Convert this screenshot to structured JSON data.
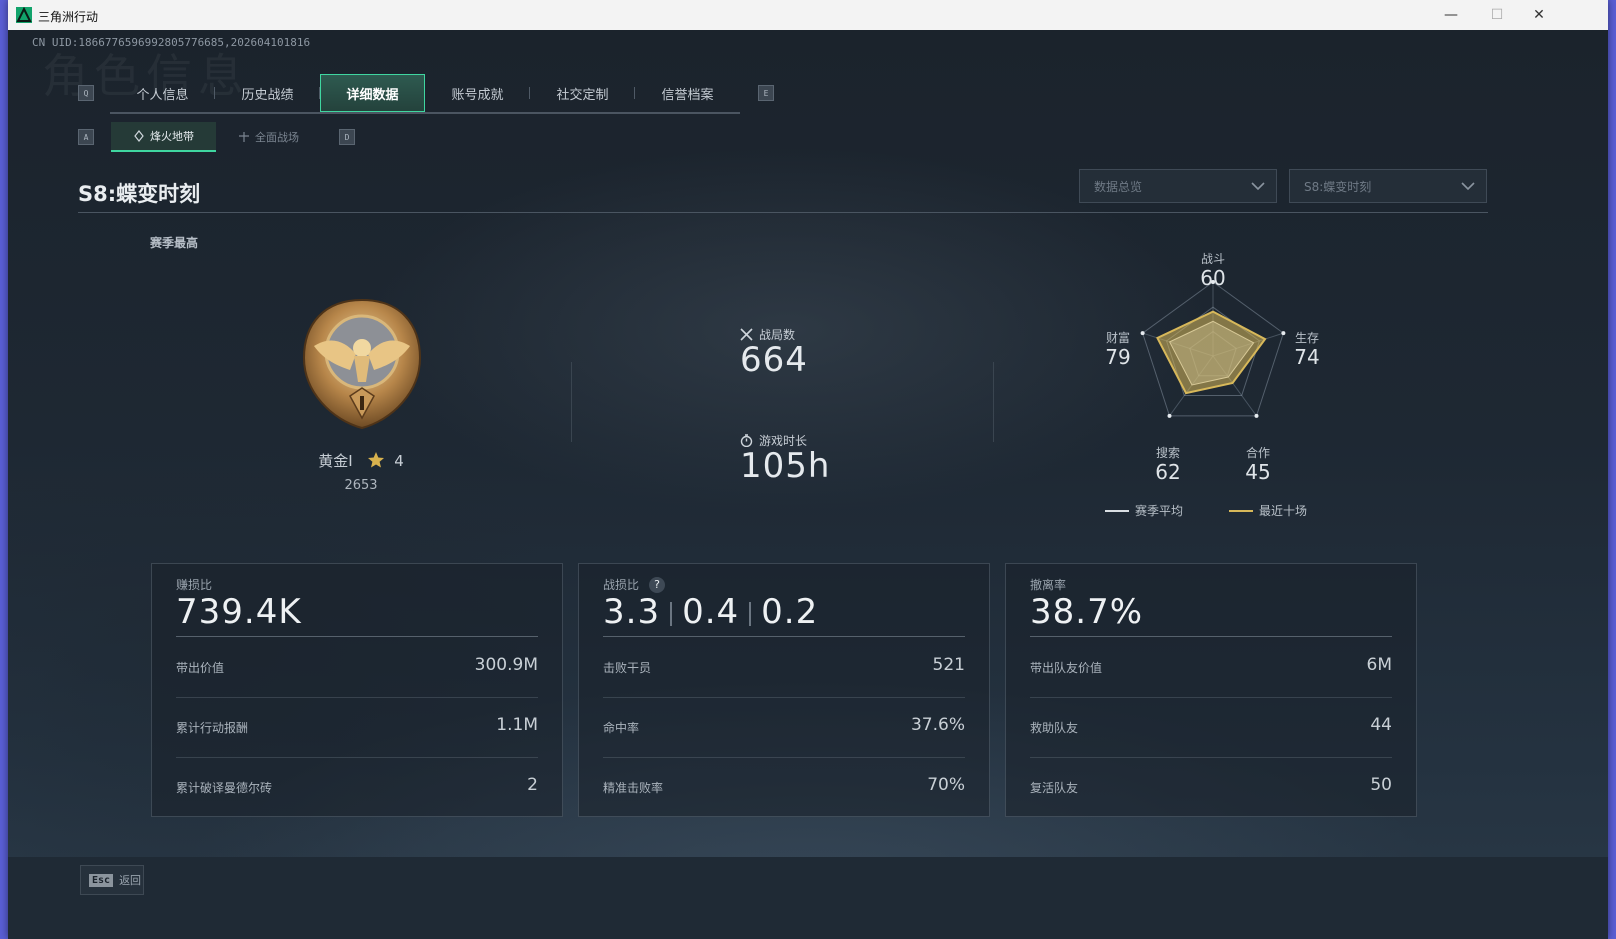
{
  "window": {
    "title": "三角洲行动",
    "min": "—",
    "max": "☐",
    "close": "✕"
  },
  "uid": "CN UID:1866776596992805776685,202604101816",
  "bg_word": "角色信息",
  "key_hints": {
    "prev_tab": "Q",
    "next_tab": "E",
    "prev_sub": "A",
    "next_sub": "D"
  },
  "tabs": [
    {
      "label": "个人信息",
      "active": false
    },
    {
      "label": "历史战绩",
      "active": false
    },
    {
      "label": "详细数据",
      "active": true
    },
    {
      "label": "账号成就",
      "active": false
    },
    {
      "label": "社交定制",
      "active": false
    },
    {
      "label": "信誉档案",
      "active": false
    }
  ],
  "subtabs": [
    {
      "label": "烽火地带",
      "icon": "zone-icon",
      "active": true
    },
    {
      "label": "全面战场",
      "icon": "battlefield-icon",
      "active": false
    }
  ],
  "season_title": "S8:蝶变时刻",
  "dropdowns": {
    "view": "数据总览",
    "season": "S8:蝶变时刻"
  },
  "season_best": {
    "label": "赛季最高",
    "rank": "黄金I",
    "stars": "4",
    "score": "2653"
  },
  "matches": {
    "label": "战局数",
    "value": "664"
  },
  "playtime": {
    "label": "游戏时长",
    "value": "105h"
  },
  "radar": {
    "labels": {
      "combat": "战斗",
      "survival": "生存",
      "coop": "合作",
      "search": "搜索",
      "wealth": "财富"
    },
    "values": {
      "combat": "60",
      "survival": "74",
      "coop": "45",
      "search": "62",
      "wealth": "79"
    },
    "legend": {
      "season_avg": "赛季平均",
      "recent": "最近十场"
    },
    "colors": {
      "season_avg": "#d9dee3",
      "recent": "#d7b85a"
    }
  },
  "cards": [
    {
      "caption": "赚损比",
      "big": "739.4K",
      "rows": [
        {
          "k": "带出价值",
          "v": "300.9M"
        },
        {
          "k": "累计行动报酬",
          "v": "1.1M"
        },
        {
          "k": "累计破译曼德尔砖",
          "v": "2"
        }
      ]
    },
    {
      "caption": "战损比",
      "big_parts": [
        "3.3",
        "0.4",
        "0.2"
      ],
      "help": "?",
      "rows": [
        {
          "k": "击败干员",
          "v": "521"
        },
        {
          "k": "命中率",
          "v": "37.6%"
        },
        {
          "k": "精准击败率",
          "v": "70%"
        }
      ]
    },
    {
      "caption": "撤离率",
      "big": "38.7%",
      "rows": [
        {
          "k": "带出队友价值",
          "v": "6M"
        },
        {
          "k": "救助队友",
          "v": "44"
        },
        {
          "k": "复活队友",
          "v": "50"
        }
      ]
    }
  ],
  "footer": {
    "esc_key": "Esc",
    "esc_label": "返回"
  }
}
